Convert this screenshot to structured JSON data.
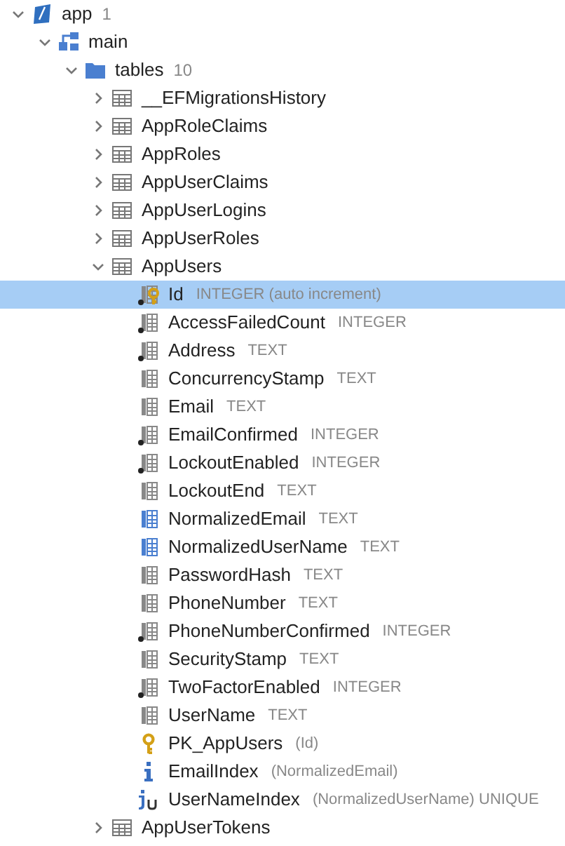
{
  "tree": [
    {
      "kind": "database",
      "name": "app",
      "count": "1",
      "expanded": true,
      "selected": false,
      "children": [
        {
          "kind": "schema",
          "name": "main",
          "expanded": true,
          "selected": false,
          "children": [
            {
              "kind": "folder",
              "name": "tables",
              "count": "10",
              "expanded": true,
              "selected": false,
              "children": [
                {
                  "kind": "table",
                  "name": "__EFMigrationsHistory",
                  "expanded": false,
                  "selected": false
                },
                {
                  "kind": "table",
                  "name": "AppRoleClaims",
                  "expanded": false,
                  "selected": false
                },
                {
                  "kind": "table",
                  "name": "AppRoles",
                  "expanded": false,
                  "selected": false
                },
                {
                  "kind": "table",
                  "name": "AppUserClaims",
                  "expanded": false,
                  "selected": false
                },
                {
                  "kind": "table",
                  "name": "AppUserLogins",
                  "expanded": false,
                  "selected": false
                },
                {
                  "kind": "table",
                  "name": "AppUserRoles",
                  "expanded": false,
                  "selected": false
                },
                {
                  "kind": "table",
                  "name": "AppUsers",
                  "expanded": true,
                  "selected": false,
                  "children": [
                    {
                      "kind": "pk_column",
                      "name": "Id",
                      "detail": "INTEGER (auto increment)",
                      "not_null": true,
                      "selected": true
                    },
                    {
                      "kind": "column",
                      "name": "AccessFailedCount",
                      "detail": "INTEGER",
                      "not_null": true,
                      "selected": false
                    },
                    {
                      "kind": "column",
                      "name": "Address",
                      "detail": "TEXT",
                      "not_null": true,
                      "selected": false
                    },
                    {
                      "kind": "column",
                      "name": "ConcurrencyStamp",
                      "detail": "TEXT",
                      "not_null": false,
                      "selected": false
                    },
                    {
                      "kind": "column",
                      "name": "Email",
                      "detail": "TEXT",
                      "not_null": false,
                      "selected": false
                    },
                    {
                      "kind": "column",
                      "name": "EmailConfirmed",
                      "detail": "INTEGER",
                      "not_null": true,
                      "selected": false
                    },
                    {
                      "kind": "column",
                      "name": "LockoutEnabled",
                      "detail": "INTEGER",
                      "not_null": true,
                      "selected": false
                    },
                    {
                      "kind": "column",
                      "name": "LockoutEnd",
                      "detail": "TEXT",
                      "not_null": false,
                      "selected": false
                    },
                    {
                      "kind": "indexed_column",
                      "name": "NormalizedEmail",
                      "detail": "TEXT",
                      "not_null": false,
                      "selected": false
                    },
                    {
                      "kind": "indexed_column",
                      "name": "NormalizedUserName",
                      "detail": "TEXT",
                      "not_null": false,
                      "selected": false
                    },
                    {
                      "kind": "column",
                      "name": "PasswordHash",
                      "detail": "TEXT",
                      "not_null": false,
                      "selected": false
                    },
                    {
                      "kind": "column",
                      "name": "PhoneNumber",
                      "detail": "TEXT",
                      "not_null": false,
                      "selected": false
                    },
                    {
                      "kind": "column",
                      "name": "PhoneNumberConfirmed",
                      "detail": "INTEGER",
                      "not_null": true,
                      "selected": false
                    },
                    {
                      "kind": "column",
                      "name": "SecurityStamp",
                      "detail": "TEXT",
                      "not_null": false,
                      "selected": false
                    },
                    {
                      "kind": "column",
                      "name": "TwoFactorEnabled",
                      "detail": "INTEGER",
                      "not_null": true,
                      "selected": false
                    },
                    {
                      "kind": "column",
                      "name": "UserName",
                      "detail": "TEXT",
                      "not_null": false,
                      "selected": false
                    },
                    {
                      "kind": "key",
                      "name": "PK_AppUsers",
                      "detail": "(Id)",
                      "selected": false
                    },
                    {
                      "kind": "index",
                      "name": "EmailIndex",
                      "detail": "(NormalizedEmail)",
                      "selected": false
                    },
                    {
                      "kind": "unique_index",
                      "name": "UserNameIndex",
                      "detail": "(NormalizedUserName) UNIQUE",
                      "selected": false
                    }
                  ]
                },
                {
                  "kind": "table",
                  "name": "AppUserTokens",
                  "expanded": false,
                  "selected": false
                }
              ]
            }
          ]
        }
      ]
    }
  ]
}
